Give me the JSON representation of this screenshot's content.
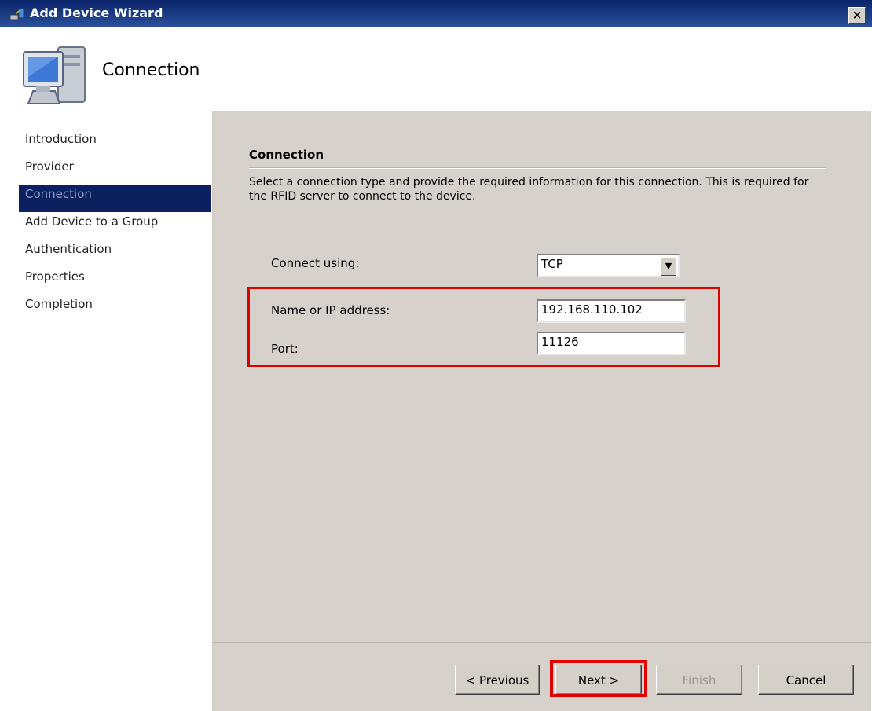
{
  "window": {
    "title": "Add Device Wizard",
    "close_label": "×"
  },
  "header": {
    "title": "Connection"
  },
  "steps": [
    {
      "label": "Introduction"
    },
    {
      "label": "Provider"
    },
    {
      "label": "Connection"
    },
    {
      "label": "Add Device to a Group"
    },
    {
      "label": "Authentication"
    },
    {
      "label": "Properties"
    },
    {
      "label": "Completion"
    }
  ],
  "active_step": "Connection",
  "section": {
    "title": "Connection",
    "description": "Select a connection type and provide the required information for this connection. This is required for the RFID server to connect to the device."
  },
  "form": {
    "connect_using_label": "Connect using:",
    "connect_using_value": "TCP",
    "name_label": "Name or IP address:",
    "name_value": "192.168.110.102",
    "port_label": "Port:",
    "port_value": "11126"
  },
  "buttons": {
    "previous": "< Previous",
    "next": "Next >",
    "finish": "Finish",
    "cancel": "Cancel"
  },
  "colors": {
    "highlight": "#e00000",
    "active_step_bg": "#0c2060",
    "panel_bg": "#d6d2cb"
  },
  "icons": {
    "title": "wizard-app-icon",
    "header": "computer-icon",
    "dropdown": "dropdown-arrow-icon"
  }
}
